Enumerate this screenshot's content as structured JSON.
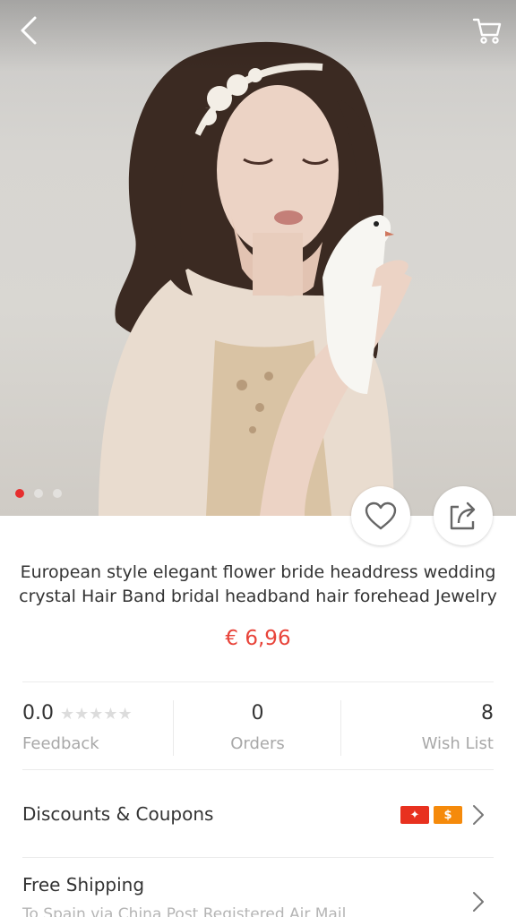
{
  "product": {
    "title": "European style elegant flower bride headdress wedding crystal Hair Band bridal headband hair forehead Jewelry",
    "price": "€ 6,96",
    "image_count": 3,
    "active_image": 1
  },
  "stats": {
    "rating": "0.0",
    "feedback_label": "Feedback",
    "orders": "0",
    "orders_label": "Orders",
    "wishlist": "8",
    "wishlist_label": "Wish List",
    "stars": "★★★★★"
  },
  "discounts": {
    "label": "Discounts & Coupons",
    "badge_1": "✦",
    "badge_2": "$"
  },
  "shipping": {
    "label": "Free Shipping",
    "detail": "To Spain via China Post Registered Air Mail"
  },
  "colors": {
    "accent": "#e62e2e",
    "price": "#e8443a",
    "badge_red": "#e8311f",
    "badge_orange": "#f58a0b"
  },
  "icons": {
    "back": "back-arrow-icon",
    "cart": "cart-icon",
    "wish": "heart-icon",
    "share": "share-icon",
    "chevron": "chevron-right-icon"
  }
}
